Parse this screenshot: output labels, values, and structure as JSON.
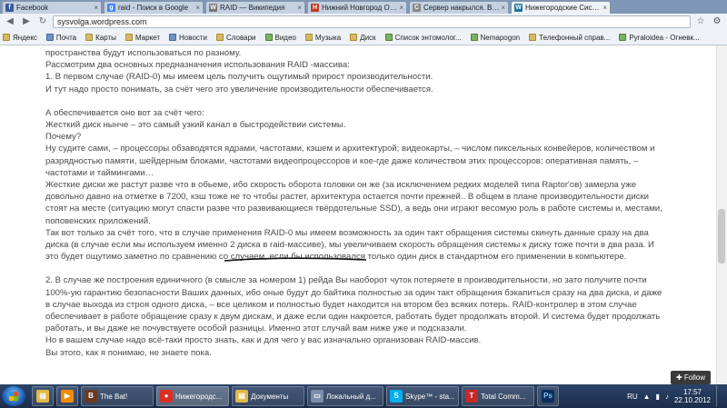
{
  "tabs": [
    {
      "label": "Facebook",
      "icon": "facebook-icon",
      "color": "#3b5998",
      "glyph": "f"
    },
    {
      "label": "raid - Поиск в Google",
      "icon": "google-icon",
      "color": "#4285f4",
      "glyph": "g"
    },
    {
      "label": "RAID — Википедия",
      "icon": "wikipedia-icon",
      "color": "#777777",
      "glyph": "W"
    },
    {
      "label": "Нижний Новгород Онлайн",
      "icon": "site-icon",
      "color": "#c0392b",
      "glyph": "Н"
    },
    {
      "label": "Сервер накрылся. Вопро...",
      "icon": "forum-icon",
      "color": "#888888",
      "glyph": "С"
    },
    {
      "label": "Нижегородские Системы...",
      "icon": "wordpress-icon",
      "color": "#21759b",
      "glyph": "W"
    }
  ],
  "address": {
    "url": "sysvolga.wordpress.com"
  },
  "bookmarks": [
    "Яндекс",
    "Почта",
    "Карты",
    "Маркет",
    "Новости",
    "Словари",
    "Видео",
    "Музыка",
    "Диск",
    "Список энтомолог...",
    "Nemapogon",
    "Телефонный справ...",
    "Pyraloidea - Огневк..."
  ],
  "article": {
    "paragraphs": [
      {
        "gap": false,
        "text": "пространства будут использоваться по разному."
      },
      {
        "gap": false,
        "text": "Рассмотрим два основных предназначения использования RAID -массива:"
      },
      {
        "gap": false,
        "text": "1. В первом случае (RAID-0) мы имеем цель получить ощутимый прирост производительности."
      },
      {
        "gap": false,
        "text": "И тут надо просто понимать, за счёт чего это увеличение производительности обеспечивается."
      },
      {
        "gap": true,
        "text": "А обеспечивается оно вот за счёт чего:"
      },
      {
        "gap": false,
        "text": "Жесткий диск нынче – это самый узкий канал в быстродействии системы."
      },
      {
        "gap": false,
        "text": "Почему?"
      },
      {
        "gap": false,
        "text": "Ну судите сами, – процессоры обзаводятся ядрами, частотами, кэшем и архитектурой; видеокарты, – числом пиксельных конвейеров, количеством и разрядностью памяти, шейдерным блоками, частотами видеопроцессоров и кое-где даже количеством этих процессоров; оперативная память, – частотами и таймингами…"
      },
      {
        "gap": false,
        "text": "Жесткие диски же растут разве что в обьеме, ибо скорость оборота головки он же (за исключением редких моделей типа Raptor'ов) замерла уже довольно давно на отметке в 7200, кэш тоже не то чтобы растет, архитектура остается почти прежней.. В общем в плане производительности диски стоят на месте (ситуацию могут спасти разве что развивающиеся твёрдотельные SSD), а ведь они играют весомую роль в работе системы и, местами, поповенских приложений."
      },
      {
        "gap": false,
        "text": "Так вот только за счёт того, что в случае применения RAID-0 мы имеем возможность за один такт обращения системы скинуть данные сразу на два диска (в случае если мы используем именно 2 диска в raid-массиве), мы увеличиваем скорость обращения системы к диску тоже почти в два раза. И это будет ощутимо заметно по сравнению со случаем, если бы использовался только один диск в стандартном его применении в компьютере."
      },
      {
        "gap": true,
        "text": "2. В случае же построения единичного (в смысле за номером 1) рейда Вы наоборот чуток потеряете в производительности, но зато получите почти 100%-ую гарантию безопасности Ваших данных, ибо оные будут до байтика полностью за один такт обращения бэкапиться сразу на два диска, и даже в случае выхода из строя одного диска, – все целиком и полностью будет находится на втором без всяких потерь. RAID-контролер в этом случае обеспечивает в работе обращение сразу к двум дискам, и даже если один накроется, работать будет продолжать второй. И система будет продолжать работать, и вы даже не почувствуете особой разницы. Именно этот случай вам ниже уже и подсказали."
      },
      {
        "gap": false,
        "text": "Но в вашем случае надо всё-таки просто знать, как и для чего у вас изначально организован RAID-массив."
      },
      {
        "gap": false,
        "text": "Вы этого, как я понимаю, не знаете пока."
      }
    ]
  },
  "follow_label": "✚ Follow",
  "taskbar": {
    "apps": [
      {
        "label": "The Bat!",
        "icon": "thebat-icon",
        "color": "#6b3a1f",
        "glyph": "B"
      },
      {
        "label": "Нижегородс...",
        "icon": "chrome-icon",
        "color": "#d93025",
        "glyph": "●"
      },
      {
        "label": "Документы",
        "icon": "folder-icon",
        "color": "#e1b84a",
        "glyph": "▤"
      },
      {
        "label": "Локальный д...",
        "icon": "drive-icon",
        "color": "#7a8ea8",
        "glyph": "▭"
      },
      {
        "label": "Skype™ - sta...",
        "icon": "skype-icon",
        "color": "#00aff0",
        "glyph": "S"
      },
      {
        "label": "Total Comm...",
        "icon": "totalcommander-icon",
        "color": "#c62828",
        "glyph": "T"
      }
    ],
    "lang": "RU",
    "time": "17:57",
    "date": "22.10.2012"
  }
}
